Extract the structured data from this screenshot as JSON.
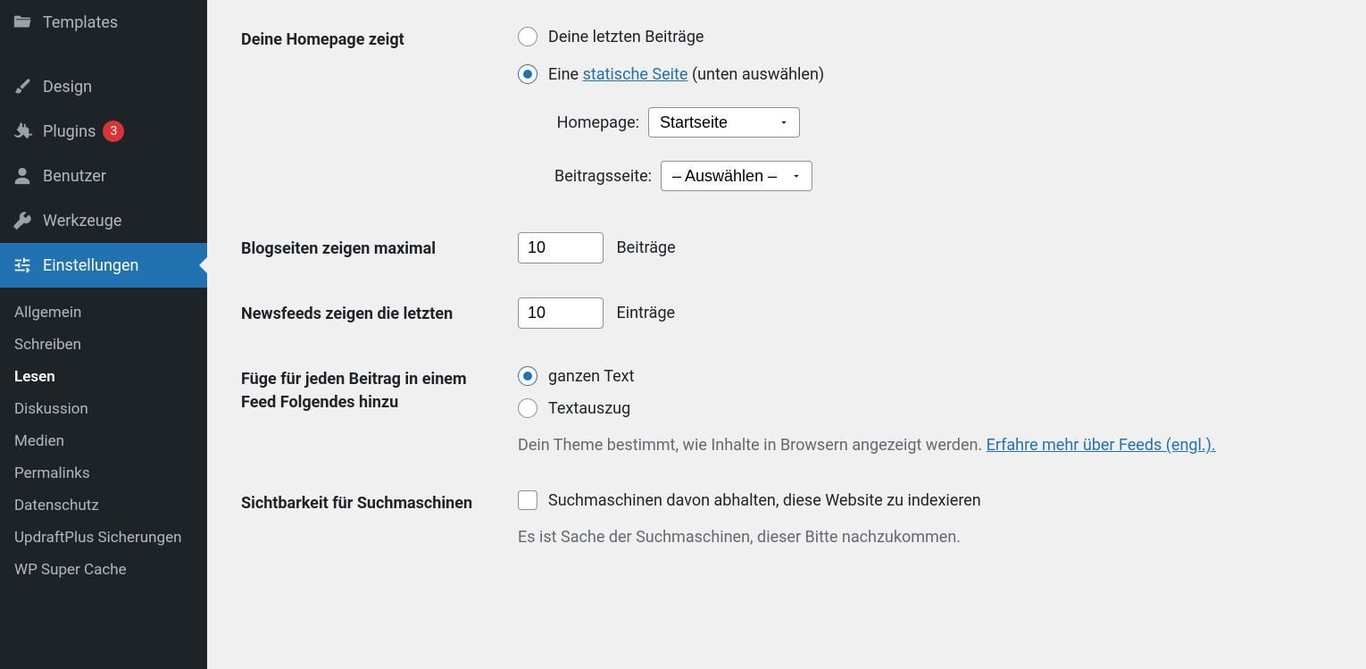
{
  "sidebar": {
    "primary": [
      {
        "id": "templates",
        "label": "Templates"
      },
      {
        "id": "design",
        "label": "Design"
      },
      {
        "id": "plugins",
        "label": "Plugins",
        "badge": "3"
      },
      {
        "id": "users",
        "label": "Benutzer"
      },
      {
        "id": "tools",
        "label": "Werkzeuge"
      },
      {
        "id": "settings",
        "label": "Einstellungen",
        "current": true
      }
    ],
    "submenu": [
      {
        "id": "general",
        "label": "Allgemein"
      },
      {
        "id": "writing",
        "label": "Schreiben"
      },
      {
        "id": "reading",
        "label": "Lesen",
        "current": true
      },
      {
        "id": "discussion",
        "label": "Diskussion"
      },
      {
        "id": "media",
        "label": "Medien"
      },
      {
        "id": "permalinks",
        "label": "Permalinks"
      },
      {
        "id": "privacy",
        "label": "Datenschutz"
      },
      {
        "id": "updraftplus",
        "label": "UpdraftPlus Sicherungen"
      },
      {
        "id": "wpsupercache",
        "label": "WP Super Cache"
      }
    ]
  },
  "settings": {
    "homepage_displays": {
      "legend": "Deine Homepage zeigt",
      "option_posts": "Deine letzten Beiträge",
      "option_static_prefix": "Eine ",
      "option_static_link": "statische Seite",
      "option_static_suffix": " (unten auswählen)",
      "homepage_label": "Homepage:",
      "homepage_value": "Startseite",
      "postspage_label": "Beitragsseite:",
      "postspage_value": "– Auswählen –"
    },
    "blog_pages": {
      "legend": "Blogseiten zeigen maximal",
      "value": "10",
      "suffix": "Beiträge"
    },
    "feeds": {
      "legend": "Newsfeeds zeigen die letzten",
      "value": "10",
      "suffix": "Einträge"
    },
    "feed_content": {
      "legend": "Füge für jeden Beitrag in einem Feed Folgendes hinzu",
      "option_full": "ganzen Text",
      "option_summary": "Textauszug",
      "description_plain": "Dein Theme bestimmt, wie Inhalte in Browsern angezeigt werden. ",
      "description_link": "Erfahre mehr über Feeds (engl.)."
    },
    "search_engine": {
      "legend": "Sichtbarkeit für Suchmaschinen",
      "checkbox_label": "Suchmaschinen davon abhalten, diese Website zu indexieren",
      "description": "Es ist Sache der Suchmaschinen, dieser Bitte nachzukommen."
    }
  }
}
